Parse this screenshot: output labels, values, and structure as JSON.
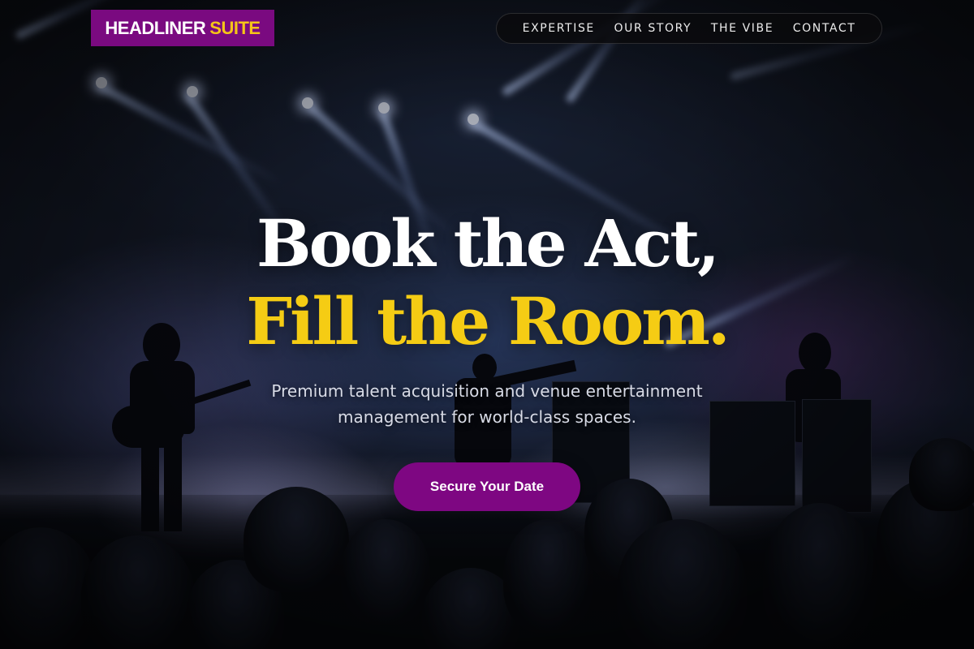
{
  "brand": {
    "name": "HEADLINER",
    "accent": "SUITE",
    "primary_color": "#7a0a80",
    "accent_color": "#f5c518"
  },
  "nav": {
    "items": [
      {
        "label": "EXPERTISE"
      },
      {
        "label": "OUR STORY"
      },
      {
        "label": "THE VIBE"
      },
      {
        "label": "CONTACT"
      }
    ]
  },
  "hero": {
    "headline_line1": "Book the Act,",
    "headline_line2": "Fill the Room.",
    "subhead": "Premium talent acquisition and venue entertainment management for world-class spaces.",
    "cta_label": "Secure Your Date",
    "background": "concert-stage-photo"
  }
}
